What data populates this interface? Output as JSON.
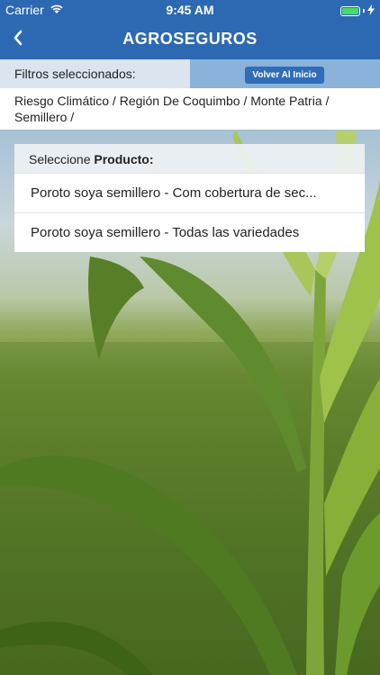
{
  "status_bar": {
    "carrier": "Carrier",
    "time": "9:45 AM"
  },
  "nav": {
    "title": "AGROSEGUROS",
    "back_icon": "chevron-left-icon"
  },
  "filters": {
    "label": "Filtros seleccionados:",
    "home_button": "Volver Al Inicio",
    "path": "Riesgo Climático / Región De Coquimbo / Monte Patria / Semillero /"
  },
  "product_selector": {
    "header_prefix": "Seleccione",
    "header_bold": "Producto:",
    "items": [
      {
        "label": "Poroto soya semillero - Com cobertura de sec..."
      },
      {
        "label": "Poroto soya semillero - Todas las variedades"
      }
    ]
  },
  "colors": {
    "brand_blue": "#2d69b3",
    "filter_label_bg": "#dbe4ef",
    "filter_right_bg": "#8ab2da",
    "battery_green": "#4cd964"
  }
}
